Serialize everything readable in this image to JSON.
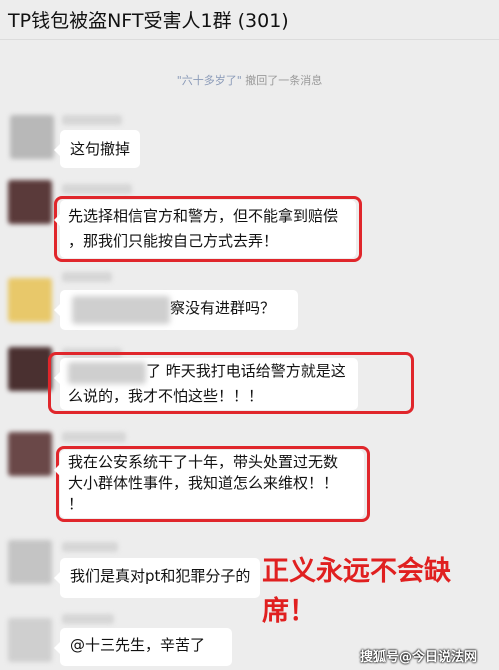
{
  "header": {
    "title": "TP钱包被盗NFT受害人1群 (301)"
  },
  "system_message": {
    "who": "\"六十多岁了\"",
    "action": " 撤回了一条消息"
  },
  "messages": [
    {
      "text": "这句撤掉"
    },
    {
      "lines": [
        "先选择相信官方和警方，但不能拿到赔偿",
        "，那我们只能按自己方式去弄！"
      ]
    },
    {
      "text": "察没有进群吗？"
    },
    {
      "lines": [
        "了 昨天我打电话给警方就是这",
        "么说的，我才不怕这些！！！"
      ]
    },
    {
      "lines": [
        "我在公安系统干了十年，带头处置过无数",
        "大小群体性事件，我知道怎么来维权！！",
        "！"
      ]
    },
    {
      "text": "我们是真对pt和犯罪分子的"
    },
    {
      "text": "@十三先生，辛苦了"
    }
  ],
  "overlay": {
    "slogan_line1": "正义永远不会缺",
    "slogan_line2": "席！"
  },
  "footer": {
    "watermark": "搜狐号@今日说法网"
  },
  "colors": {
    "highlight": "#e0262b",
    "slogan": "#e02020",
    "background": "#ededed"
  }
}
